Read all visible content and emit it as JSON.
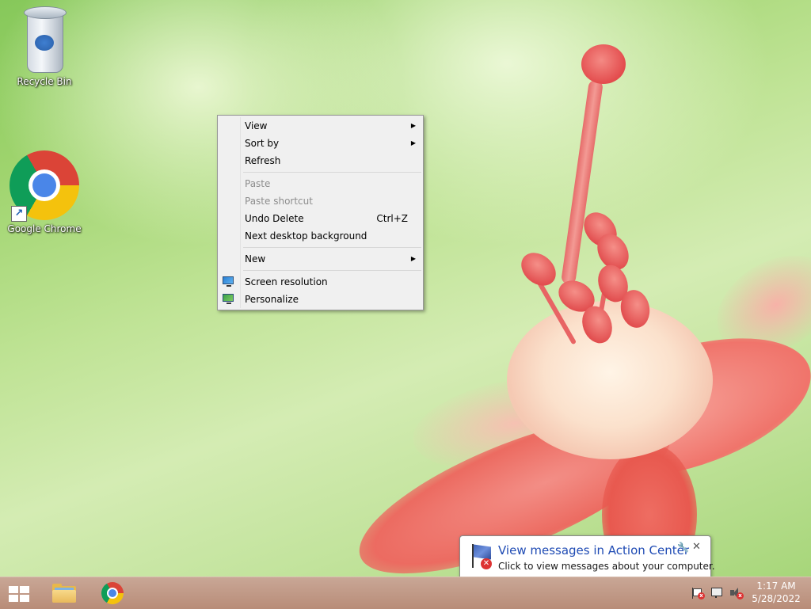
{
  "desktop": {
    "icons": [
      {
        "label": "Recycle Bin",
        "icon": "recycle-bin-icon"
      },
      {
        "label": "Google Chrome",
        "icon": "chrome-icon"
      }
    ]
  },
  "context_menu": {
    "items": [
      {
        "label": "View",
        "submenu": true
      },
      {
        "label": "Sort by",
        "submenu": true
      },
      {
        "label": "Refresh"
      },
      {
        "label": "Paste",
        "disabled": true
      },
      {
        "label": "Paste shortcut",
        "disabled": true
      },
      {
        "label": "Undo Delete",
        "shortcut": "Ctrl+Z"
      },
      {
        "label": "Next desktop background"
      },
      {
        "label": "New",
        "submenu": true
      },
      {
        "label": "Screen resolution",
        "icon": "monitor-icon"
      },
      {
        "label": "Personalize",
        "icon": "personalize-icon"
      }
    ],
    "submenu_glyph": "▶"
  },
  "notification": {
    "title": "View messages in Action Center",
    "text": "Click to view messages about your computer.",
    "close_glyph": "✕",
    "settings_glyph": "🔧"
  },
  "taskbar": {
    "buttons": [
      "start-icon",
      "file-explorer-icon",
      "chrome-icon"
    ],
    "tray": [
      "action-center-flag-icon",
      "network-icon",
      "volume-muted-icon"
    ],
    "time": "1:17 AM",
    "date": "5/28/2022",
    "error_glyph": "x"
  },
  "colors": {
    "menu_bg": "#f0f0f0",
    "balloon_title": "#1f4bb4",
    "taskbar": "#b88c78"
  }
}
